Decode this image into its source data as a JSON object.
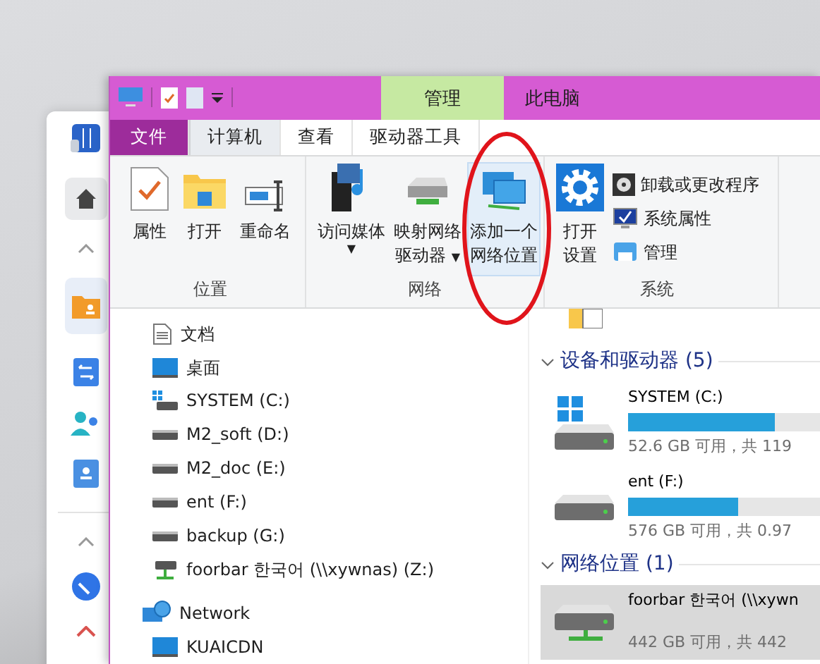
{
  "title_bar": {
    "context_tab": "管理",
    "window_title": "此电脑"
  },
  "ribbon_tabs": [
    {
      "label": "文件",
      "kind": "file",
      "selected": false
    },
    {
      "label": "计算机",
      "kind": "tab",
      "selected": true
    },
    {
      "label": "查看",
      "kind": "tab",
      "selected": false
    },
    {
      "label": "驱动器工具",
      "kind": "tab",
      "selected": false
    }
  ],
  "ribbon_groups": [
    {
      "label": "位置",
      "buttons": [
        {
          "lines": [
            "属性"
          ],
          "kind": "properties",
          "hovered": false
        },
        {
          "lines": [
            "打开"
          ],
          "kind": "folder",
          "hovered": false
        },
        {
          "lines": [
            "重命名"
          ],
          "kind": "rename",
          "hovered": false
        }
      ]
    },
    {
      "label": "网络",
      "buttons": [
        {
          "lines": [
            "访问媒体"
          ],
          "kind": "media",
          "caret": "▼",
          "hovered": false
        },
        {
          "lines": [
            "映射网络",
            "驱动器"
          ],
          "kind": "drive",
          "caret": "▼",
          "hovered": false
        },
        {
          "lines": [
            "添加一个",
            "网络位置"
          ],
          "kind": "network",
          "hovered": true
        }
      ]
    },
    {
      "label": "系统",
      "buttons": [
        {
          "lines": [
            "打开",
            "设置"
          ],
          "kind": "gear",
          "hovered": false
        }
      ],
      "small_buttons": [
        {
          "label": "卸载或更改程序",
          "kind": "disc"
        },
        {
          "label": "系统属性",
          "kind": "sysprops"
        },
        {
          "label": "管理",
          "kind": "manage"
        }
      ]
    }
  ],
  "nav_pane": [
    {
      "label": "文档",
      "kind": "document"
    },
    {
      "label": "桌面",
      "kind": "desktop"
    },
    {
      "label": "SYSTEM (C:)",
      "kind": "windrive"
    },
    {
      "label": "M2_soft (D:)",
      "kind": "drive"
    },
    {
      "label": "M2_doc (E:)",
      "kind": "drive"
    },
    {
      "label": "ent (F:)",
      "kind": "drive"
    },
    {
      "label": "backup (G:)",
      "kind": "drive"
    },
    {
      "label": "foorbar 한국어 (\\\\xywnas) (Z:)",
      "kind": "netdrive"
    },
    {
      "label": "Network",
      "kind": "globe",
      "children": [
        {
          "label": "KUAICDN",
          "kind": "desktop"
        }
      ]
    }
  ],
  "sections": [
    {
      "title": "设备和驱动器 (5)",
      "expanded": true,
      "items": [
        {
          "name": "SYSTEM (C:)",
          "kind": "windrive",
          "level": 0.6,
          "free": "52.6 GB 可用，共 119",
          "selected": false
        },
        {
          "name": "ent (F:)",
          "kind": "drive",
          "level": 0.45,
          "free": "576 GB 可用，共 0.97",
          "selected": false
        }
      ]
    },
    {
      "title": "网络位置 (1)",
      "expanded": true,
      "items": [
        {
          "name": "foorbar 한국어 (\\\\xywn",
          "kind": "netdrive",
          "free": "442 GB 可用，共 442",
          "selected": true
        }
      ]
    }
  ]
}
